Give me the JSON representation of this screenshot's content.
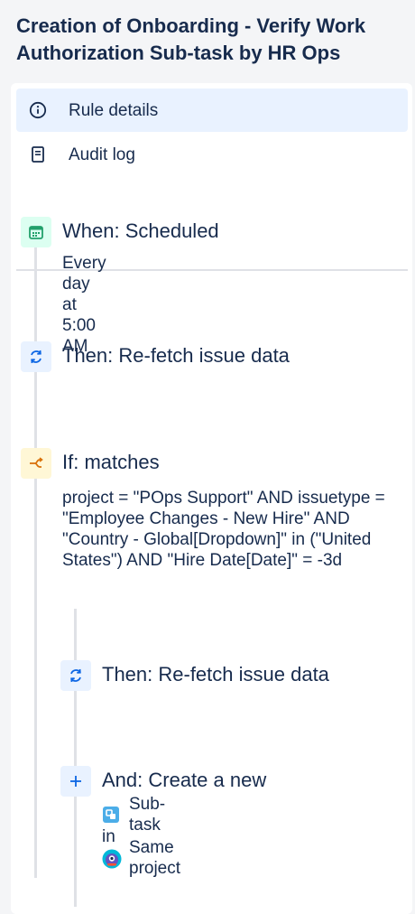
{
  "page": {
    "title": "Creation of Onboarding - Verify Work Authorization Sub-task by HR Ops"
  },
  "nav": {
    "items": [
      {
        "label": "Rule details",
        "icon": "info-icon",
        "active": true
      },
      {
        "label": "Audit log",
        "icon": "document-icon",
        "active": false
      }
    ]
  },
  "steps": {
    "trigger": {
      "heading": "When: Scheduled",
      "detail": "Every day at 5:00 AM",
      "icon": "calendar-icon",
      "color": "#22a06b"
    },
    "refetch1": {
      "heading": "Then: Re-fetch issue data",
      "icon": "refresh-icon",
      "color": "#0c66e4"
    },
    "condition": {
      "heading": "If: matches",
      "jql": "project = \"POps Support\" AND issuetype = \"Employee Changes - New Hire\" AND \"Country - Global[Dropdown]\" in (\"United States\") AND \"Hire Date[Date]\" = -3d",
      "icon": "branch-icon",
      "color": "#d97008"
    },
    "refetch2": {
      "heading": "Then: Re-fetch issue data",
      "icon": "refresh-icon",
      "color": "#0c66e4"
    },
    "create": {
      "heading": "And: Create a new",
      "icon": "plus-icon",
      "issue_type": "Sub-task",
      "connector": "in",
      "project": "Same project",
      "color": "#0c66e4"
    }
  }
}
